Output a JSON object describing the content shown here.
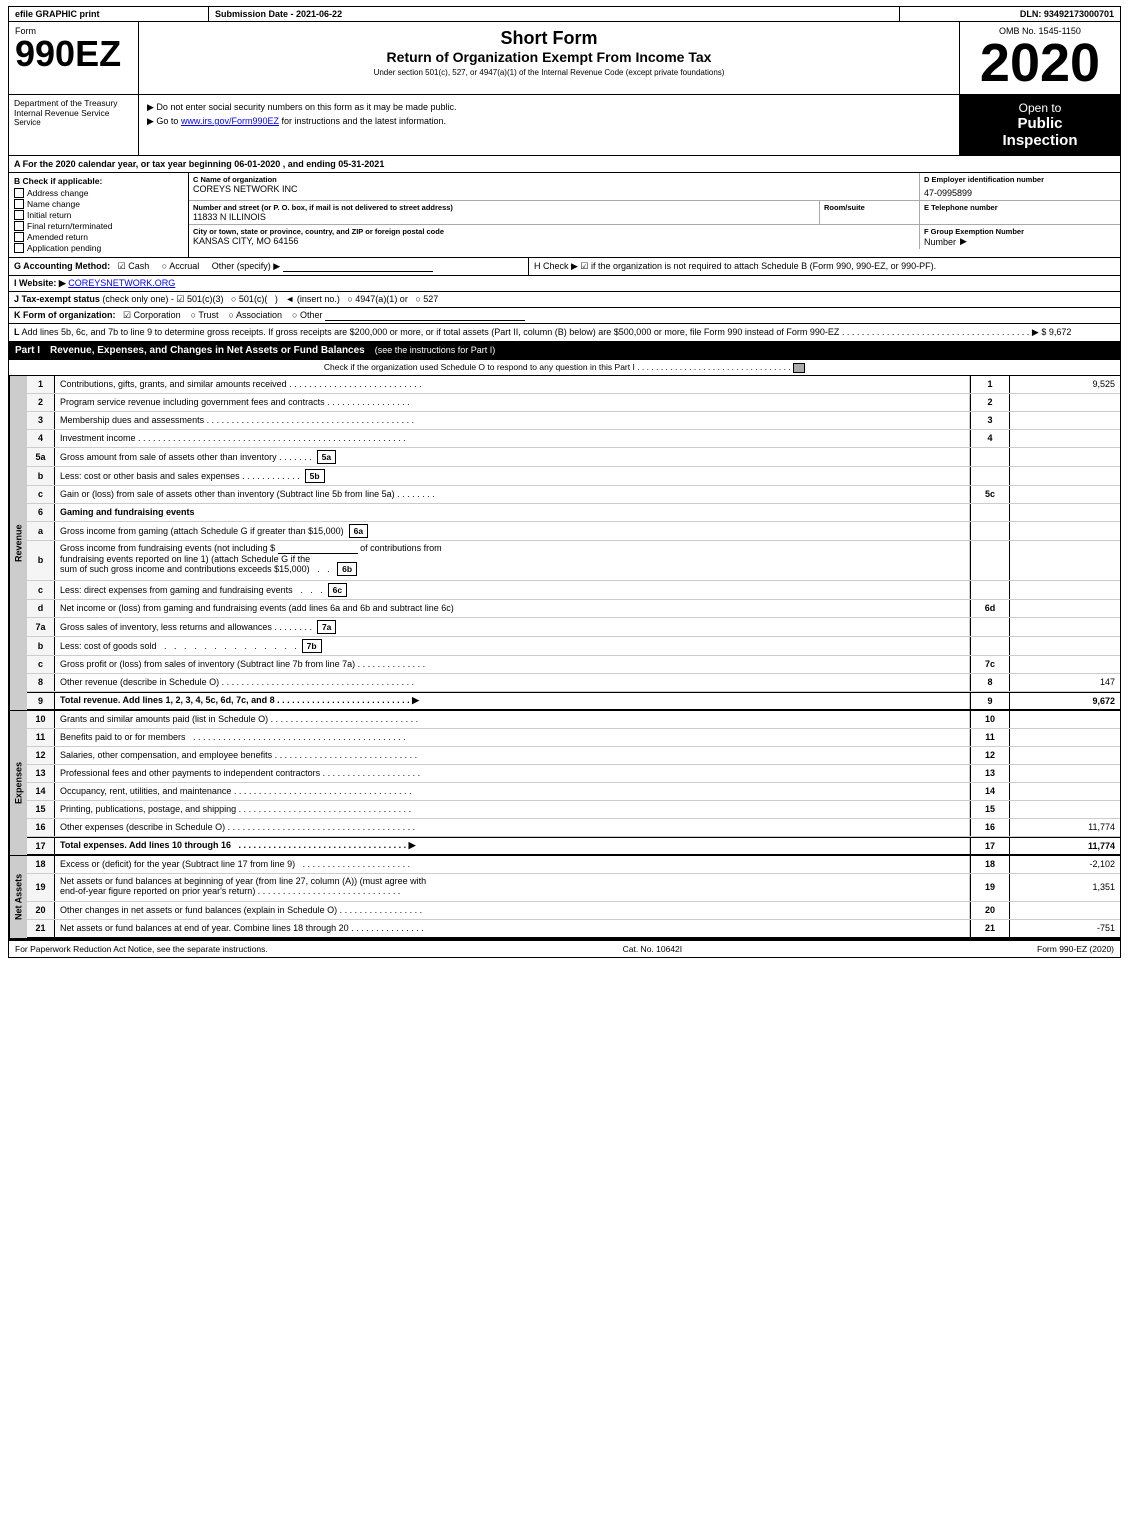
{
  "header": {
    "efile": "efile GRAPHIC print",
    "submission_label": "Submission Date -",
    "submission_date": "2021-06-22",
    "dln_label": "DLN:",
    "dln_number": "93492173000701",
    "form_number": "990EZ",
    "form_label": "Form",
    "short_form": "Short Form",
    "return_title": "Return of Organization Exempt From Income Tax",
    "under_section": "Under section 501(c), 527, or 4947(a)(1) of the Internal Revenue Code (except private foundations)",
    "notice1": "▶ Do not enter social security numbers on this form as it may be made public.",
    "notice2": "▶ Go to www.irs.gov/Form990EZ for instructions and the latest information.",
    "irs_url": "www.irs.gov/Form990EZ",
    "year": "2020",
    "omb": "OMB No. 1545-1150",
    "open_to_public": "Open to Public Inspection",
    "open_line1": "Open to",
    "open_line2": "Public",
    "open_line3": "Inspection"
  },
  "dept": {
    "name": "Department of the Treasury",
    "division": "Internal Revenue Service"
  },
  "section_a": {
    "text": "A  For the 2020 calendar year, or tax year beginning 06-01-2020 , and ending 05-31-2021"
  },
  "section_b": {
    "label": "B  Check if applicable:",
    "items": [
      {
        "label": "Address change"
      },
      {
        "label": "Name change"
      },
      {
        "label": "Initial return"
      },
      {
        "label": "Final return/terminated"
      },
      {
        "label": "Amended return"
      },
      {
        "label": "Application pending"
      }
    ]
  },
  "org_info": {
    "c_label": "C Name of organization",
    "org_name": "COREYS NETWORK INC",
    "d_label": "D Employer identification number",
    "ein": "47-0995899",
    "address_label": "Number and street (or P. O. box, if mail is not delivered to street address)",
    "address": "11833 N ILLINOIS",
    "room_label": "Room/suite",
    "room": "",
    "e_label": "E Telephone number",
    "telephone": "",
    "city_label": "City or town, state or province, country, and ZIP or foreign postal code",
    "city": "KANSAS CITY, MO  64156",
    "f_label": "F Group Exemption Number",
    "group_num": ""
  },
  "section_g": {
    "text": "G Accounting Method:",
    "cash_label": "Cash",
    "accrual_label": "Accrual",
    "other_label": "Other (specify) ▶",
    "cash_checked": true
  },
  "section_h": {
    "text": "H  Check ▶  ☑ if the organization is not required to attach Schedule B (Form 990, 990-EZ, or 990-PF)."
  },
  "website": {
    "label": "I Website: ▶",
    "url": "COREYSNETWORK.ORG"
  },
  "tax_status": {
    "label": "J Tax-exempt status (check only one) -",
    "options": [
      "✔ 501(c)(3)",
      "○ 501(c)(",
      ")",
      "◄ (insert no.)",
      "○ 4947(a)(1) or",
      "○ 527"
    ]
  },
  "form_org": {
    "label": "K Form of organization:",
    "options": [
      "✔ Corporation",
      "○ Trust",
      "○ Association",
      "○ Other"
    ]
  },
  "line_l": {
    "text": "L Add lines 5b, 6c, and 7b to line 9 to determine gross receipts. If gross receipts are $200,000 or more, or if total assets (Part II, column (B) below) are $500,000 or more, file Form 990 instead of Form 990-EZ",
    "dots": ".",
    "amount": "▶ $ 9,672"
  },
  "part1": {
    "title": "Part I",
    "title_desc": "Revenue, Expenses, and Changes in Net Assets or Fund Balances",
    "see_instructions": "(see the instructions for Part I)",
    "check_line": "Check if the organization used Schedule O to respond to any question in this Part I",
    "rows": [
      {
        "num": "1",
        "desc": "Contributions, gifts, grants, and similar amounts received",
        "ref": "1",
        "value": "9,525"
      },
      {
        "num": "2",
        "desc": "Program service revenue including government fees and contracts",
        "ref": "2",
        "value": ""
      },
      {
        "num": "3",
        "desc": "Membership dues and assessments",
        "ref": "3",
        "value": ""
      },
      {
        "num": "4",
        "desc": "Investment income",
        "ref": "4",
        "value": ""
      },
      {
        "num": "5a",
        "desc": "Gross amount from sale of assets other than inventory",
        "ref": "5a",
        "value": ""
      },
      {
        "num": "5b",
        "desc": "Less: cost or other basis and sales expenses",
        "ref": "5b",
        "value": ""
      },
      {
        "num": "5c",
        "desc": "Gain or (loss) from sale of assets other than inventory (Subtract line 5b from line 5a)",
        "ref": "5c",
        "value": ""
      },
      {
        "num": "6",
        "desc": "Gaming and fundraising events",
        "ref": "",
        "value": ""
      },
      {
        "num": "6a",
        "desc": "Gross income from gaming (attach Schedule G if greater than $15,000)",
        "ref": "6a",
        "value": ""
      },
      {
        "num": "6b",
        "desc": "Gross income from fundraising events (not including $  of contributions from fundraising events reported on line 1) (attach Schedule G if the sum of such gross income and contributions exceeds $15,000)",
        "ref": "6b",
        "value": ""
      },
      {
        "num": "6c",
        "desc": "Less: direct expenses from gaming and fundraising events",
        "ref": "6c",
        "value": ""
      },
      {
        "num": "6d",
        "desc": "Net income or (loss) from gaming and fundraising events (add lines 6a and 6b and subtract line 6c)",
        "ref": "6d",
        "value": ""
      },
      {
        "num": "7a",
        "desc": "Gross sales of inventory, less returns and allowances",
        "ref": "7a",
        "value": ""
      },
      {
        "num": "7b",
        "desc": "Less: cost of goods sold",
        "ref": "7b",
        "value": ""
      },
      {
        "num": "7c",
        "desc": "Gross profit or (loss) from sales of inventory (Subtract line 7b from line 7a)",
        "ref": "7c",
        "value": ""
      },
      {
        "num": "8",
        "desc": "Other revenue (describe in Schedule O)",
        "ref": "8",
        "value": "147"
      },
      {
        "num": "9",
        "desc": "Total revenue. Add lines 1, 2, 3, 4, 5c, 6d, 7c, and 8",
        "ref": "9",
        "value": "9,672",
        "bold": true,
        "arrow": true
      }
    ]
  },
  "part1_expenses": {
    "rows": [
      {
        "num": "10",
        "desc": "Grants and similar amounts paid (list in Schedule O)",
        "ref": "10",
        "value": ""
      },
      {
        "num": "11",
        "desc": "Benefits paid to or for members",
        "ref": "11",
        "value": ""
      },
      {
        "num": "12",
        "desc": "Salaries, other compensation, and employee benefits",
        "ref": "12",
        "value": ""
      },
      {
        "num": "13",
        "desc": "Professional fees and other payments to independent contractors",
        "ref": "13",
        "value": ""
      },
      {
        "num": "14",
        "desc": "Occupancy, rent, utilities, and maintenance",
        "ref": "14",
        "value": ""
      },
      {
        "num": "15",
        "desc": "Printing, publications, postage, and shipping",
        "ref": "15",
        "value": ""
      },
      {
        "num": "16",
        "desc": "Other expenses (describe in Schedule O)",
        "ref": "16",
        "value": "11,774"
      },
      {
        "num": "17",
        "desc": "Total expenses. Add lines 10 through 16",
        "ref": "17",
        "value": "11,774",
        "bold": true,
        "arrow": true
      }
    ]
  },
  "part1_assets": {
    "rows": [
      {
        "num": "18",
        "desc": "Excess or (deficit) for the year (Subtract line 17 from line 9)",
        "ref": "18",
        "value": "-2,102"
      },
      {
        "num": "19",
        "desc": "Net assets or fund balances at beginning of year (from line 27, column (A)) (must agree with end-of-year figure reported on prior year's return)",
        "ref": "19",
        "value": "1,351"
      },
      {
        "num": "20",
        "desc": "Other changes in net assets or fund balances (explain in Schedule O)",
        "ref": "20",
        "value": ""
      },
      {
        "num": "21",
        "desc": "Net assets or fund balances at end of year. Combine lines 18 through 20",
        "ref": "21",
        "value": "-751"
      }
    ]
  },
  "footer": {
    "paperwork": "For Paperwork Reduction Act Notice, see the separate instructions.",
    "cat_no": "Cat. No. 10642I",
    "form_ref": "Form 990-EZ (2020)"
  }
}
